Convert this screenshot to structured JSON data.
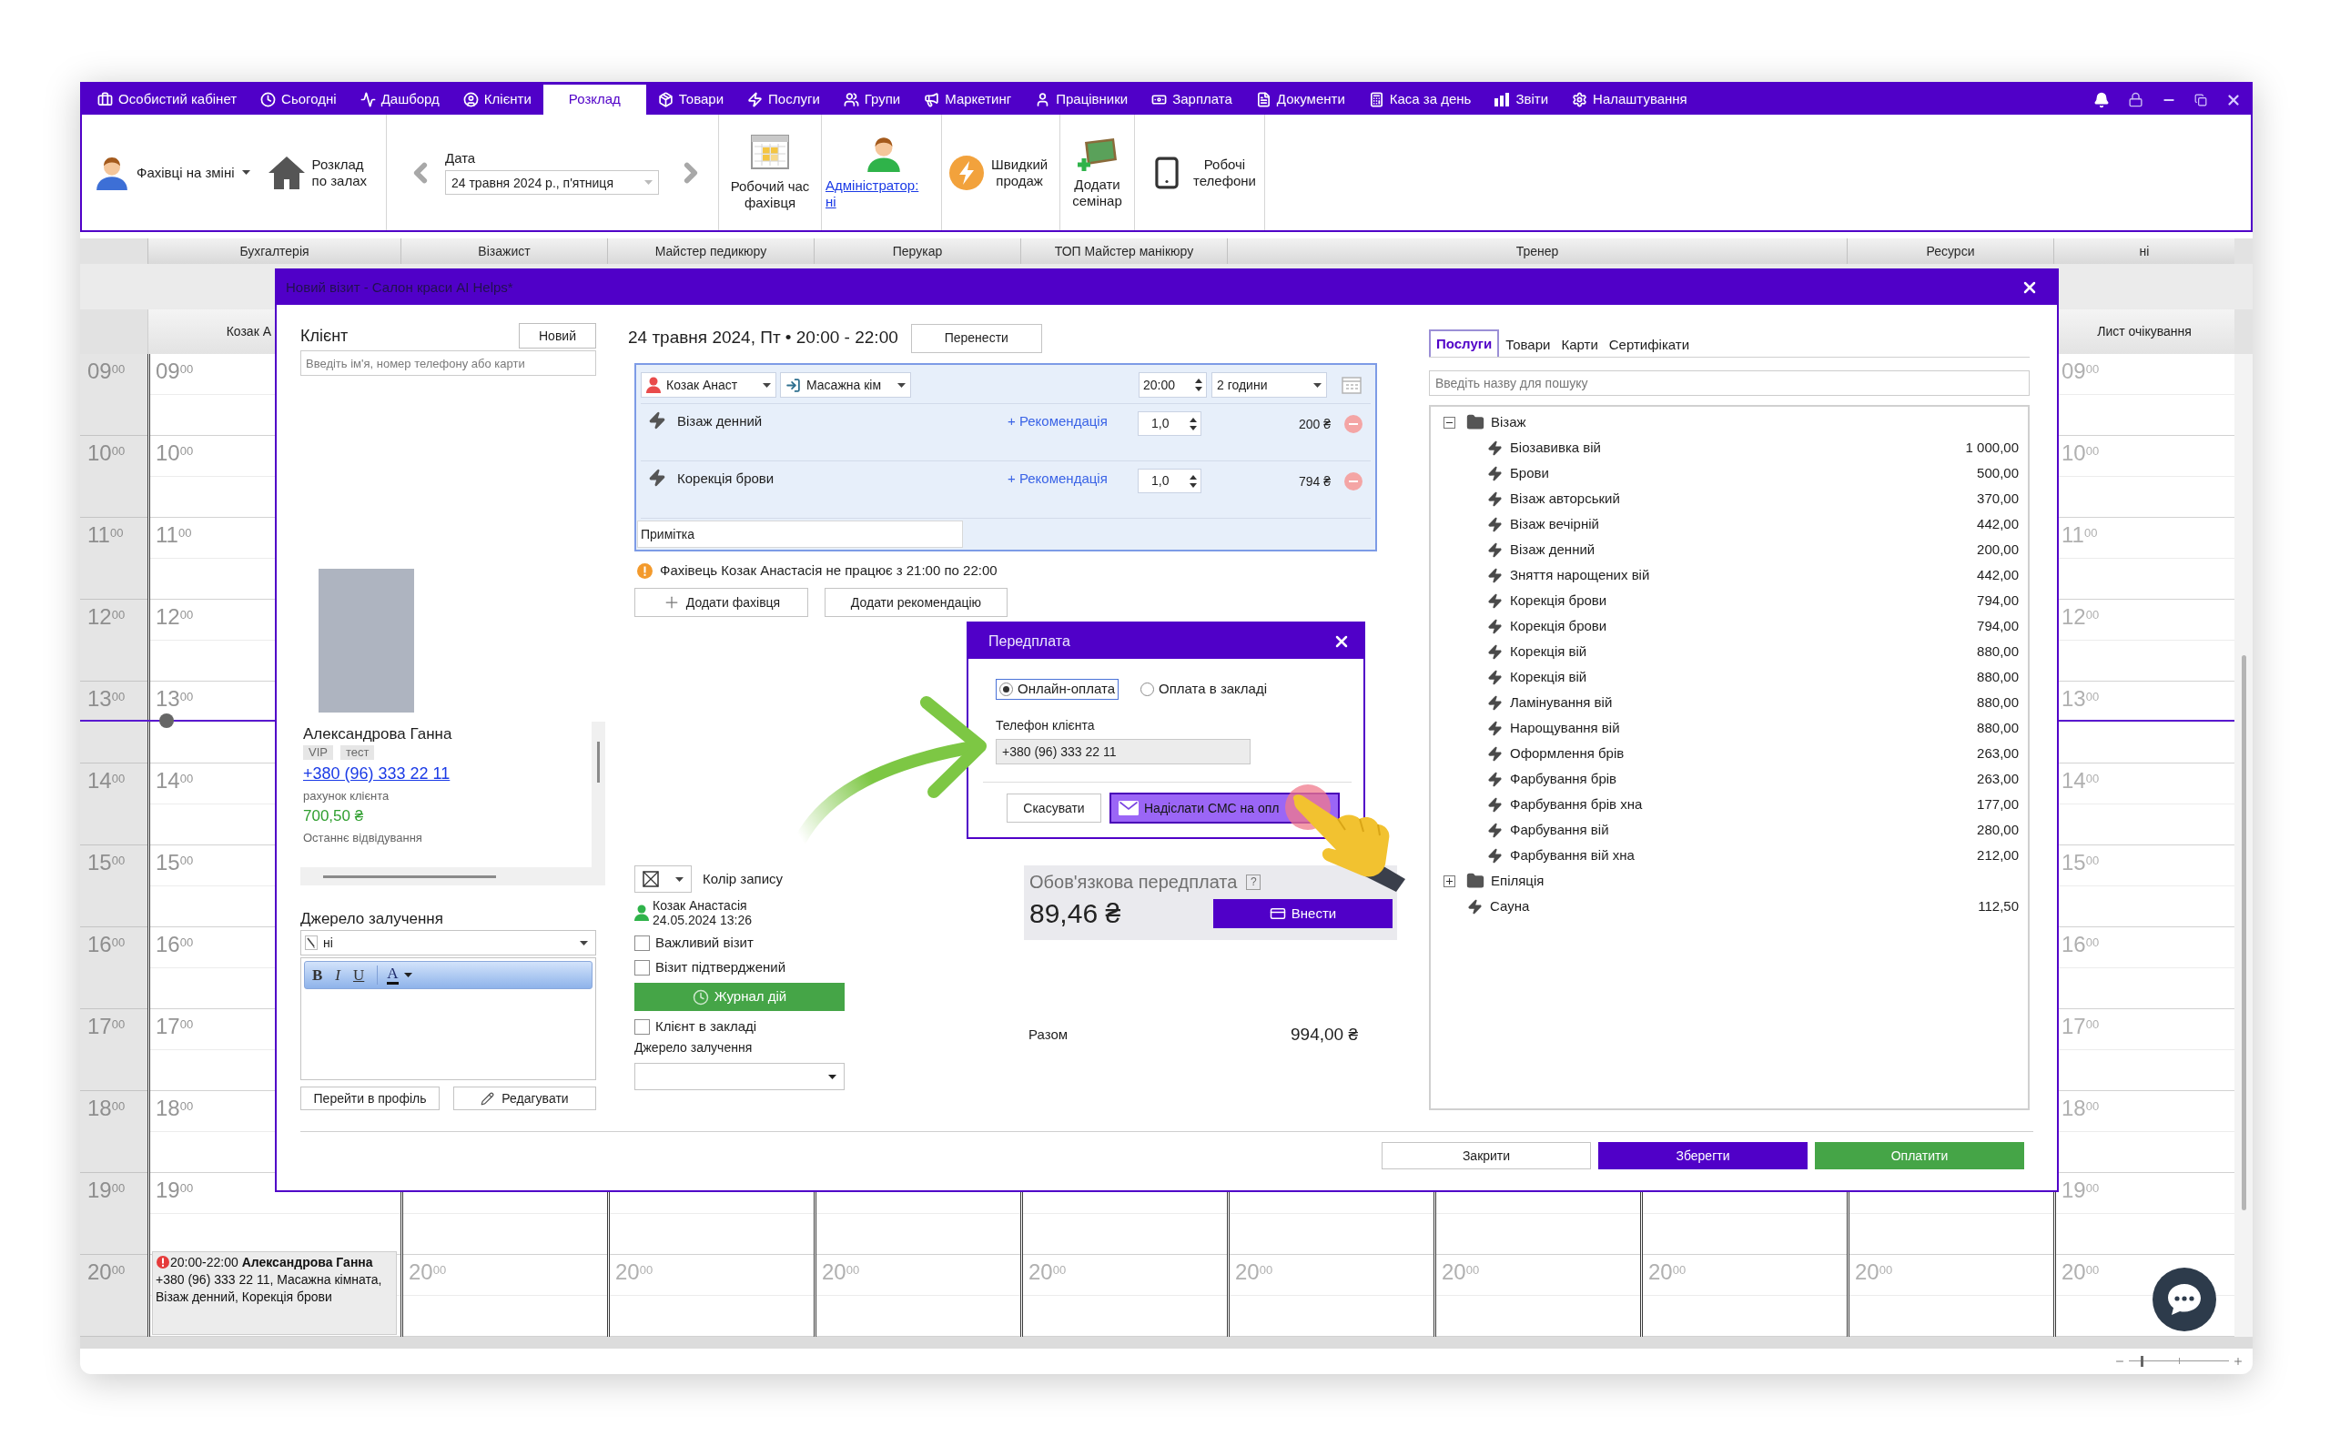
{
  "menu": [
    {
      "label": "Особистий кабінет",
      "selected": false
    },
    {
      "label": "Сьогодні",
      "selected": false
    },
    {
      "label": "Дашборд",
      "selected": false
    },
    {
      "label": "Клієнти",
      "selected": false
    },
    {
      "label": "Розклад",
      "selected": true
    },
    {
      "label": "Товари",
      "selected": false
    },
    {
      "label": "Послуги",
      "selected": false
    },
    {
      "label": "Групи",
      "selected": false
    },
    {
      "label": "Маркетинг",
      "selected": false
    },
    {
      "label": "Працівники",
      "selected": false
    },
    {
      "label": "Зарплата",
      "selected": false
    },
    {
      "label": "Документи",
      "selected": false
    },
    {
      "label": "Каса за день",
      "selected": false
    },
    {
      "label": "Звіти",
      "selected": false
    },
    {
      "label": "Налаштування",
      "selected": false
    }
  ],
  "toolbar": {
    "staff_on_shift": "Фахівці на зміні",
    "halls_schedule": "Розклад\nпо залах",
    "date_label": "Дата",
    "date_value": "24 травня 2024 р., п'ятниця",
    "work_time": "Робочий час\nфахівця",
    "administrator": "Адміністратор:\nні",
    "quick_sale": "Швидкий\nпродаж",
    "add_seminar": "Додати\nсемінар",
    "work_phones": "Робочі\nтелефони"
  },
  "calendar": {
    "time_column": [
      "09$^{00}$",
      "10$^{00}$",
      "11$^{00}$",
      "12$^{00}$",
      "13$^{00}$",
      "14$^{00}$",
      "15$^{00}$",
      "16$^{00}$",
      "17$^{00}$",
      "18$^{00}$",
      "19$^{00}$",
      "20$^{00}$"
    ],
    "groups": [
      {
        "label": "Бухгалтерія",
        "columns": [
          {
            "kind": "visible",
            "staff": "Козак А",
            "active": true,
            "hour_labels": [
              "09$^{00}$",
              "10$^{00}$",
              "11$^{00}$",
              "12$^{00}$",
              "13$^{00}$",
              "14$^{00}$",
              "15$^{00}$",
              "16$^{00}$",
              "17$^{00}$",
              "18$^{00}$",
              "19$^{00}$"
            ],
            "events": [
              {
                "warning": true,
                "text": "20:00-22:00 **Александрова Ганна** +380 (96) 333 22 11, Масажна кімната, Візаж денний, Корекція брови"
              }
            ]
          }
        ]
      },
      {
        "label": "Візажист",
        "columns": [
          {
            "kind": "covered",
            "active": false,
            "hour_labels": [
              "20$^{00}$"
            ]
          }
        ]
      },
      {
        "label": "Майстер педикюру",
        "columns": [
          {
            "kind": "covered",
            "active": false,
            "hour_labels": [
              "20$^{00}$"
            ]
          }
        ]
      },
      {
        "label": "Перукар",
        "columns": [
          {
            "kind": "covered",
            "active": false,
            "hour_labels": [
              "20$^{00}$"
            ]
          }
        ]
      },
      {
        "label": "ТОП Майстер манікюру",
        "columns": [
          {
            "kind": "covered",
            "active": false,
            "hour_labels": [
              "20$^{00}$"
            ]
          }
        ]
      },
      {
        "label": "Тренер",
        "columns": [
          {
            "kind": "covered",
            "active": false,
            "hour_labels": [
              "20$^{00}$"
            ]
          },
          {
            "kind": "covered",
            "active": false,
            "hour_labels": [
              "20$^{00}$"
            ]
          },
          {
            "kind": "covered",
            "active": false,
            "hour_labels": [
              "20$^{00}$"
            ]
          }
        ]
      },
      {
        "label": "Ресурси",
        "columns": [
          {
            "kind": "covered",
            "active": false,
            "hour_labels": [
              "20$^{00}$"
            ]
          }
        ]
      },
      {
        "label": "ні",
        "columns": [
          {
            "kind": "visible",
            "staff": "Лист очікування",
            "active": false,
            "hour_labels": [
              "09$^{00}$",
              "10$^{00}$",
              "11$^{00}$",
              "12$^{00}$",
              "13$^{00}$",
              "14$^{00}$",
              "15$^{00}$",
              "16$^{00}$",
              "17$^{00}$",
              "18$^{00}$",
              "19$^{00}$",
              "20$^{00}$"
            ]
          }
        ]
      }
    ]
  },
  "dialog": {
    "title": "Новий візит - Салон краси AI Helps*",
    "client": {
      "label": "Клієнт",
      "new_button": "Новий",
      "search_placeholder": "Введіть ім'я, номер телефону або карти",
      "name": "Александрова Ганна",
      "tags": [
        "VIP",
        "тест"
      ],
      "phone": "+380 (96) 333 22 11",
      "account_label": "рахунок клієнта",
      "account_balance": "700,50 ₴",
      "last_visit_label": "Останнє відвідування",
      "source_label": "Джерело залучення",
      "source_value": "ні",
      "format_buttons": [
        {
          "kind": "bold",
          "label": "B"
        },
        {
          "kind": "italic",
          "label": "I"
        },
        {
          "kind": "underline",
          "label": "U"
        },
        {
          "kind": "color",
          "label": "A"
        }
      ],
      "profile_button": "Перейти в профіль",
      "edit_button": "Редагувати"
    },
    "visit": {
      "date_time": "24 травня 2024, Пт • 20:00 - 22:00",
      "move_button": "Перенести",
      "specialist": "Козак Анаст",
      "room": "Масажна кім",
      "start_time": "20:00",
      "duration": "2 години",
      "services": [
        {
          "name": "Візаж денний",
          "recommendation": "+ Рекомендація",
          "quantity": "1,0",
          "price": "200 ₴"
        },
        {
          "name": "Корекція брови",
          "recommendation": "+ Рекомендація",
          "quantity": "1,0",
          "price": "794 ₴"
        }
      ],
      "note_placeholder": "Примітка",
      "warning": "Фахівець Козак Анастасія не працює з 21:00 по 22:00",
      "add_specialist_button": "Додати фахівця",
      "add_recommendation_button": "Додати рекомендацію"
    },
    "details": {
      "record_color_label": "Колір запису",
      "author": "Козак Анастасія",
      "created": "24.05.2024 13:26",
      "checkboxes": [
        {
          "label": "Важливий візит",
          "checked": false
        },
        {
          "label": "Візит підтверджений",
          "checked": false
        }
      ],
      "log_button": "Журнал дій",
      "client_in_salon": {
        "label": "Клієнт в закладі",
        "checked": false
      },
      "source_label": "Джерело залучення"
    },
    "prepayment": {
      "title": "Обов'язкова передплата",
      "help": "?",
      "amount": "89,46 ₴",
      "button": "Внести"
    },
    "total": {
      "label": "Разом",
      "value": "994,00 ₴"
    },
    "catalog": {
      "tabs": [
        {
          "label": "Послуги",
          "selected": true
        },
        {
          "label": "Товари",
          "selected": false
        },
        {
          "label": "Карти",
          "selected": false
        },
        {
          "label": "Сертифікати",
          "selected": false
        }
      ],
      "search_placeholder": "Введіть назву для пошуку",
      "tree": [
        {
          "kind": "folder",
          "label": "Візаж",
          "expanded": true,
          "children": [
            {
              "kind": "service",
              "label": "Біозавивка вій",
              "price": "1 000,00"
            },
            {
              "kind": "service",
              "label": "Брови",
              "price": "500,00"
            },
            {
              "kind": "service",
              "label": "Візаж авторський",
              "price": "370,00"
            },
            {
              "kind": "service",
              "label": "Візаж вечірній",
              "price": "442,00"
            },
            {
              "kind": "service",
              "label": "Візаж денний",
              "price": "200,00"
            },
            {
              "kind": "service",
              "label": "Зняття нарощених вій",
              "price": "442,00"
            },
            {
              "kind": "service",
              "label": "Корекція брови",
              "price": "794,00"
            },
            {
              "kind": "service",
              "label": "Корекція брови",
              "price": "794,00"
            },
            {
              "kind": "service",
              "label": "Корекція вій",
              "price": "880,00"
            },
            {
              "kind": "service",
              "label": "Корекція вій",
              "price": "880,00"
            },
            {
              "kind": "service",
              "label": "Ламінування вій",
              "price": "880,00"
            },
            {
              "kind": "service",
              "label": "Нарощування вій",
              "price": "880,00"
            },
            {
              "kind": "service",
              "label": "Оформлення брів",
              "price": "263,00"
            },
            {
              "kind": "service",
              "label": "Фарбування брів",
              "price": "263,00"
            },
            {
              "kind": "service",
              "label": "Фарбування брів хна",
              "price": "177,00"
            },
            {
              "kind": "service",
              "label": "Фарбування вій",
              "price": "280,00"
            },
            {
              "kind": "service",
              "label": "Фарбування вій хна",
              "price": "212,00"
            }
          ]
        },
        {
          "kind": "folder",
          "label": "Епіляція",
          "expanded": false
        },
        {
          "kind": "service",
          "label": "Сауна",
          "price": "112,50"
        }
      ]
    },
    "footer_buttons": [
      {
        "kind": "default",
        "label": "Закрити"
      },
      {
        "kind": "primary",
        "label": "Зберегти"
      },
      {
        "kind": "success",
        "label": "Оплатити"
      }
    ]
  },
  "prepayment_popup": {
    "title": "Передплата",
    "options": [
      {
        "label": "Онлайн-оплата",
        "selected": true
      },
      {
        "label": "Оплата в закладі",
        "selected": false
      }
    ],
    "phone_label": "Телефон клієнта",
    "phone_value": "+380 (96) 333 22 11",
    "cancel_button": "Скасувати",
    "send_button": "Надіслати СМС на опл"
  },
  "zoom_slider": {
    "level": 0.12
  }
}
